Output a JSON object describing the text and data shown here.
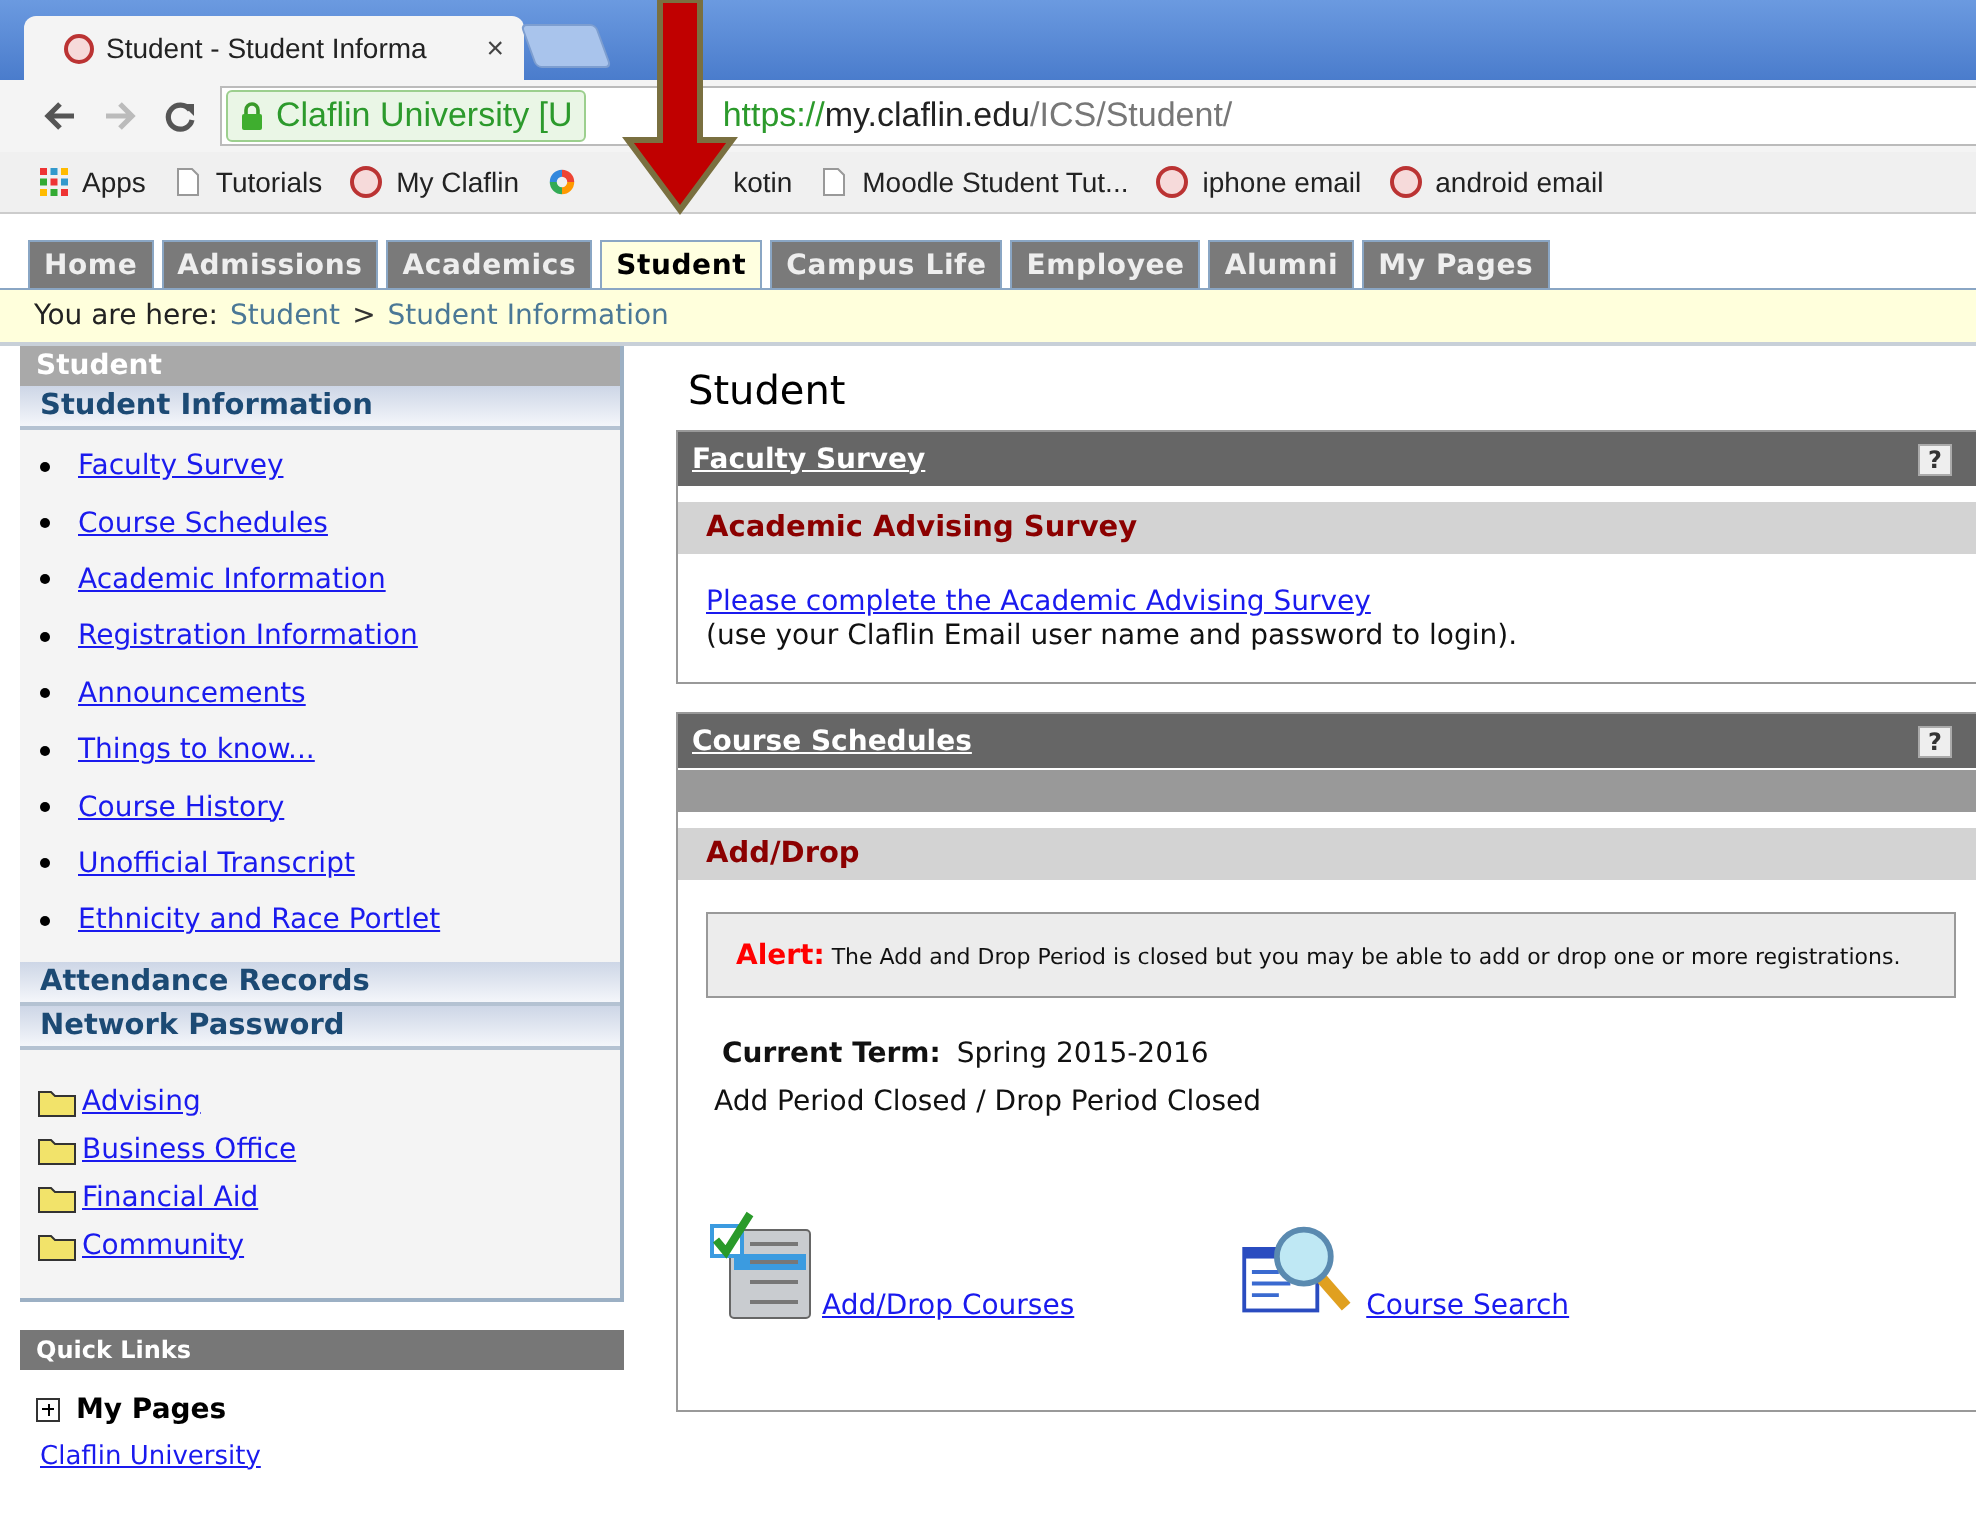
{
  "browser": {
    "tabs": [
      {
        "kind": "page",
        "title": "Student - Student Informa",
        "selected": true,
        "close": "×"
      },
      {
        "kind": "new",
        "selected": false
      }
    ],
    "address": {
      "secure_label": "Claflin University [U",
      "url_scheme": "https://",
      "url_host": "my.claflin.edu",
      "url_path": "/ICS/Student/"
    },
    "bookmarks": [
      {
        "label": "Apps",
        "kind": "apps"
      },
      {
        "label": "Tutorials",
        "kind": "page"
      },
      {
        "label": "My Claflin",
        "kind": "seal"
      },
      {
        "label": "kotin",
        "kind": "swirl"
      },
      {
        "label": "Moodle Student Tut...",
        "kind": "page"
      },
      {
        "label": "iphone email",
        "kind": "seal"
      },
      {
        "label": "android email",
        "kind": "seal"
      }
    ]
  },
  "portal": {
    "nav_tabs": [
      {
        "label": "Home",
        "selected": false
      },
      {
        "label": "Admissions",
        "selected": false
      },
      {
        "label": "Academics",
        "selected": false
      },
      {
        "label": "Student",
        "selected": true
      },
      {
        "label": "Campus Life",
        "selected": false
      },
      {
        "label": "Employee",
        "selected": false
      },
      {
        "label": "Alumni",
        "selected": false
      },
      {
        "label": "My Pages",
        "selected": false
      }
    ],
    "breadcrumb": {
      "prefix": "You are here:",
      "separator": ">",
      "path": [
        "Student",
        "Student Information"
      ]
    }
  },
  "sidebar": {
    "title": "Student",
    "sections": [
      {
        "label": "Student Information",
        "links": [
          "Faculty Survey",
          "Course Schedules",
          "Academic Information",
          "Registration Information",
          "Announcements",
          "Things to know...",
          "Course History",
          "Unofficial Transcript",
          "Ethnicity and Race Portlet"
        ]
      },
      {
        "label": "Attendance Records"
      },
      {
        "label": "Network Password"
      }
    ],
    "folders": [
      "Advising",
      "Business Office",
      "Financial Aid",
      "Community"
    ],
    "quick_links": {
      "title": "Quick Links",
      "groups": [
        {
          "label": "My Pages",
          "expanded": false
        }
      ],
      "link": "Claflin University"
    }
  },
  "main": {
    "title": "Student",
    "portlets": [
      {
        "title": "Faculty Survey",
        "help": "?",
        "bar": false,
        "subheader": "Academic Advising Survey",
        "kind": "survey",
        "link": "Please complete the Academic Advising Survey",
        "note": "(use your Claflin Email user name and password to login)."
      },
      {
        "title": "Course Schedules",
        "help": "?",
        "bar": true,
        "subheader": "Add/Drop",
        "kind": "adddrop",
        "alert_label": "Alert:",
        "alert_text": "The Add and Drop Period is closed but you may be able to add or drop one or more registrations.",
        "term_label": "Current Term:",
        "term_value": "Spring 2015-2016",
        "status": "Add Period Closed / Drop Period Closed",
        "actions": [
          {
            "label": "Add/Drop Courses",
            "kind": "checklist"
          },
          {
            "label": "Course Search",
            "kind": "search"
          }
        ]
      }
    ]
  }
}
